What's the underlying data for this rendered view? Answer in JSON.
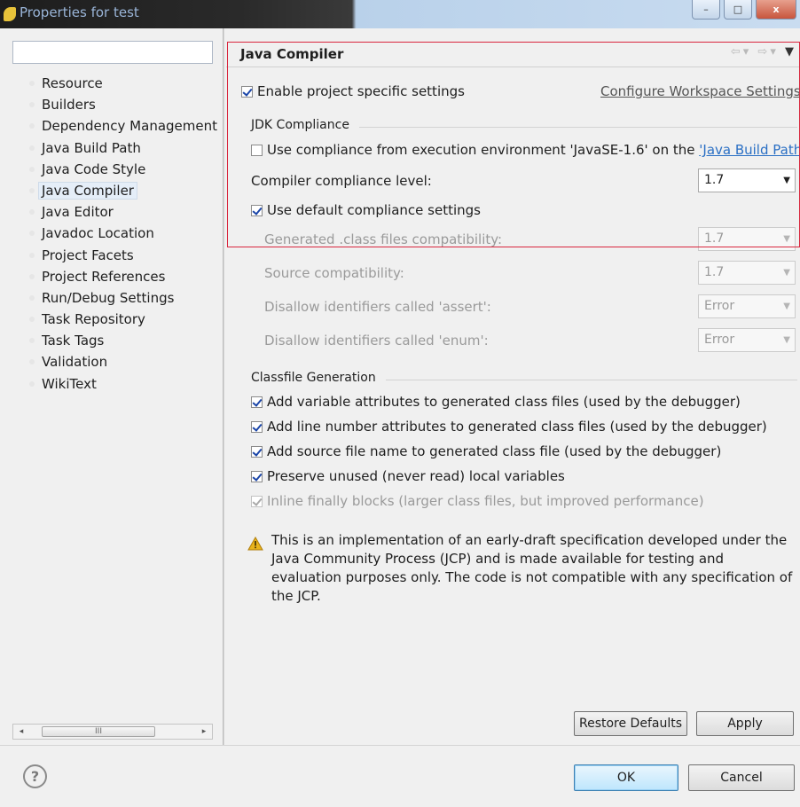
{
  "window": {
    "title": "Properties for test",
    "minimize": "–",
    "maximize": "□",
    "close": "x"
  },
  "filter": {
    "value": "",
    "placeholder": ""
  },
  "tree": {
    "items": [
      "Resource",
      "Builders",
      "Dependency Management",
      "Java Build Path",
      "Java Code Style",
      "Java Compiler",
      "Java Editor",
      "Javadoc Location",
      "Project Facets",
      "Project References",
      "Run/Debug Settings",
      "Task Repository",
      "Task Tags",
      "Validation",
      "WikiText"
    ],
    "selected": "Java Compiler"
  },
  "scrollbar": {
    "left": "◂",
    "right": "▸",
    "thumb": "III"
  },
  "page": {
    "title": "Java Compiler",
    "nav": {
      "back": "⇦",
      "back_menu": "▾",
      "forward": "⇨",
      "forward_menu": "▾",
      "view_menu": "▼"
    },
    "enable_specific": {
      "label": "Enable project specific settings",
      "checked": true
    },
    "configure_link": "Configure Workspace Settings..."
  },
  "jdk": {
    "group_title": "JDK Compliance",
    "use_exec_env": {
      "text": "Use compliance from execution environment 'JavaSE-1.6' on the ",
      "link": "'Java Build Path'",
      "checked": false
    },
    "compliance_level": {
      "label": "Compiler compliance level:",
      "value": "1.7"
    },
    "use_default": {
      "label": "Use default compliance settings",
      "checked": true
    },
    "generated": {
      "label": "Generated .class files compatibility:",
      "value": "1.7"
    },
    "source": {
      "label": "Source compatibility:",
      "value": "1.7"
    },
    "assert_ids": {
      "label": "Disallow identifiers called 'assert':",
      "value": "Error"
    },
    "enum_ids": {
      "label": "Disallow identifiers called 'enum':",
      "value": "Error"
    }
  },
  "classfile": {
    "group_title": "Classfile Generation",
    "options": [
      {
        "label": "Add variable attributes to generated class files (used by the debugger)",
        "checked": true,
        "enabled": true
      },
      {
        "label": "Add line number attributes to generated class files (used by the debugger)",
        "checked": true,
        "enabled": true
      },
      {
        "label": "Add source file name to generated class file (used by the debugger)",
        "checked": true,
        "enabled": true
      },
      {
        "label": "Preserve unused (never read) local variables",
        "checked": true,
        "enabled": true
      },
      {
        "label": "Inline finally blocks (larger class files, but improved performance)",
        "checked": true,
        "enabled": false
      }
    ]
  },
  "warning": "This is an implementation of an early-draft specification developed under the Java Community Process (JCP) and is made available for testing and evaluation purposes only. The code is not compatible with any specification of the JCP.",
  "buttons": {
    "restore": "Restore Defaults",
    "apply": "Apply",
    "ok": "OK",
    "cancel": "Cancel",
    "help": "?"
  },
  "colors": {
    "highlight_frame": "#d9273e",
    "link": "#2a6fc4",
    "warning": "#e8b31c"
  }
}
